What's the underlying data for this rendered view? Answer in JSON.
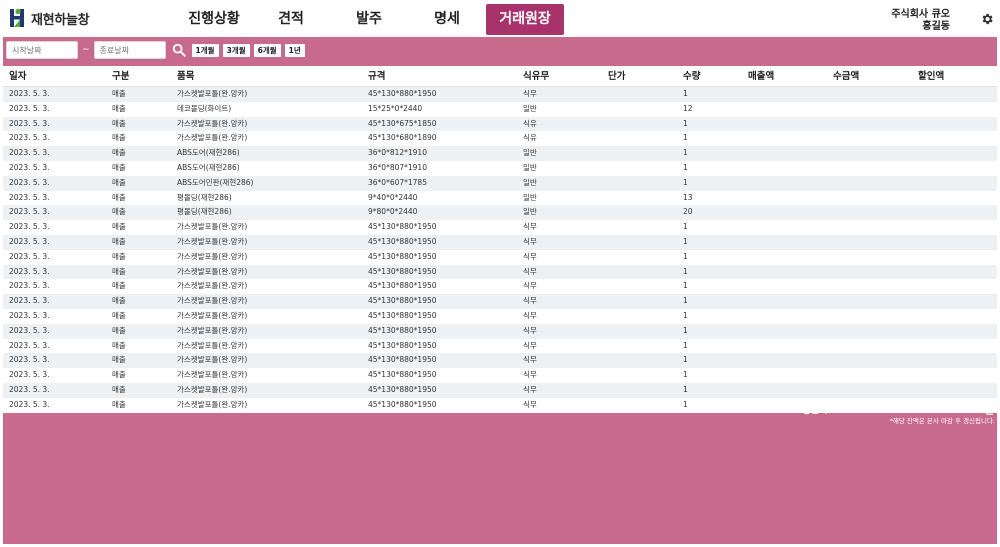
{
  "app": {
    "logo_text": "재현하늘창",
    "brand_colors": {
      "green": "#5aa83a",
      "navy": "#1f3a6e",
      "accent": "#a8336a",
      "panel": "#c76a8b"
    }
  },
  "nav": {
    "tabs": [
      {
        "label": "진행상황",
        "active": false
      },
      {
        "label": "견적",
        "active": false
      },
      {
        "label": "발주",
        "active": false
      },
      {
        "label": "명세",
        "active": false
      },
      {
        "label": "거래원장",
        "active": true
      }
    ]
  },
  "user": {
    "company": "주식회사 큐오",
    "name": "홍길동",
    "settings_icon": "gear-icon"
  },
  "filter": {
    "start_placeholder": "시작날짜",
    "end_placeholder": "종료날짜",
    "separator": "~",
    "search_icon": "search-icon",
    "periods": [
      "1개월",
      "3개월",
      "6개월",
      "1년"
    ]
  },
  "table": {
    "columns": [
      "일자",
      "구분",
      "품목",
      "규격",
      "식유무",
      "단가",
      "수량",
      "매출액",
      "수금액",
      "할인액"
    ],
    "rows": [
      [
        "2023. 5. 3.",
        "매출",
        "가스켓발포틀(완.앙카)",
        "45*130*880*1950",
        "식무",
        "",
        "1",
        "",
        "",
        ""
      ],
      [
        "2023. 5. 3.",
        "매출",
        "데코몰딩(화이트)",
        "15*25*0*2440",
        "일반",
        "",
        "12",
        "",
        "",
        ""
      ],
      [
        "2023. 5. 3.",
        "매출",
        "가스켓발포틀(완.앙카)",
        "45*130*675*1850",
        "식유",
        "",
        "1",
        "",
        "",
        ""
      ],
      [
        "2023. 5. 3.",
        "매출",
        "가스켓발포틀(완.앙카)",
        "45*130*680*1890",
        "식유",
        "",
        "1",
        "",
        "",
        ""
      ],
      [
        "2023. 5. 3.",
        "매출",
        "ABS도어(재현286)",
        "36*0*812*1910",
        "일반",
        "",
        "1",
        "",
        "",
        ""
      ],
      [
        "2023. 5. 3.",
        "매출",
        "ABS도어(재현286)",
        "36*0*807*1910",
        "일반",
        "",
        "1",
        "",
        "",
        ""
      ],
      [
        "2023. 5. 3.",
        "매출",
        "ABS도어민판(재현286)",
        "36*0*607*1785",
        "일반",
        "",
        "1",
        "",
        "",
        ""
      ],
      [
        "2023. 5. 3.",
        "매출",
        "평몰딩(재현286)",
        "9*40*0*2440",
        "일반",
        "",
        "13",
        "",
        "",
        ""
      ],
      [
        "2023. 5. 3.",
        "매출",
        "평몰딩(재현286)",
        "9*80*0*2440",
        "일반",
        "",
        "20",
        "",
        "",
        ""
      ],
      [
        "2023. 5. 3.",
        "매출",
        "가스켓발포틀(완.앙카)",
        "45*130*880*1950",
        "식무",
        "",
        "1",
        "",
        "",
        ""
      ],
      [
        "2023. 5. 3.",
        "매출",
        "가스켓발포틀(완.앙카)",
        "45*130*880*1950",
        "식무",
        "",
        "1",
        "",
        "",
        ""
      ],
      [
        "2023. 5. 3.",
        "매출",
        "가스켓발포틀(완.앙카)",
        "45*130*880*1950",
        "식무",
        "",
        "1",
        "",
        "",
        ""
      ],
      [
        "2023. 5. 3.",
        "매출",
        "가스켓발포틀(완.앙카)",
        "45*130*880*1950",
        "식무",
        "",
        "1",
        "",
        "",
        ""
      ],
      [
        "2023. 5. 3.",
        "매출",
        "가스켓발포틀(완.앙카)",
        "45*130*880*1950",
        "식무",
        "",
        "1",
        "",
        "",
        ""
      ],
      [
        "2023. 5. 3.",
        "매출",
        "가스켓발포틀(완.앙카)",
        "45*130*880*1950",
        "식무",
        "",
        "1",
        "",
        "",
        ""
      ],
      [
        "2023. 5. 3.",
        "매출",
        "가스켓발포틀(완.앙카)",
        "45*130*880*1950",
        "식무",
        "",
        "1",
        "",
        "",
        ""
      ],
      [
        "2023. 5. 3.",
        "매출",
        "가스켓발포틀(완.앙카)",
        "45*130*880*1950",
        "식무",
        "",
        "1",
        "",
        "",
        ""
      ],
      [
        "2023. 5. 3.",
        "매출",
        "가스켓발포틀(완.앙카)",
        "45*130*880*1950",
        "식무",
        "",
        "1",
        "",
        "",
        ""
      ],
      [
        "2023. 5. 3.",
        "매출",
        "가스켓발포틀(완.앙카)",
        "45*130*880*1950",
        "식무",
        "",
        "1",
        "",
        "",
        ""
      ],
      [
        "2023. 5. 3.",
        "매출",
        "가스켓발포틀(완.앙카)",
        "45*130*880*1950",
        "식무",
        "",
        "1",
        "",
        "",
        ""
      ],
      [
        "2023. 5. 3.",
        "매출",
        "가스켓발포틀(완.앙카)",
        "45*130*880*1950",
        "식무",
        "",
        "1",
        "",
        "",
        ""
      ],
      [
        "2023. 5. 3.",
        "매출",
        "가스켓발포틀(완.앙카)",
        "45*130*880*1950",
        "식무",
        "",
        "1",
        "",
        "",
        ""
      ]
    ]
  },
  "summary": {
    "total_label": "총잔액 :",
    "total_value": "",
    "unit": "원",
    "note": "*해당 잔액은 본사 마감 후 갱신됩니다."
  }
}
